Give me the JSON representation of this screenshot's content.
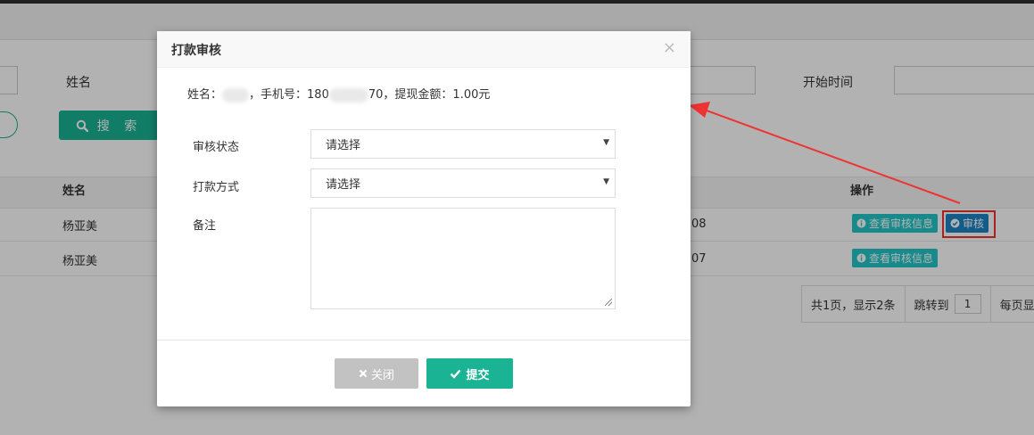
{
  "background": {
    "filter": {
      "name_label": "姓名",
      "start_time_label": "开始时间",
      "search_button": "搜 索"
    },
    "table": {
      "headers": {
        "name": "姓名",
        "actions": "操作"
      },
      "rows": [
        {
          "name": "杨亚美",
          "time_fragment": "08",
          "view_label": "查看审核信息",
          "audit_label": "审核"
        },
        {
          "name": "杨亚美",
          "time_fragment": "07",
          "view_label": "查看审核信息"
        }
      ]
    },
    "pager": {
      "summary": "共1页，显示2条",
      "jump_label": "跳转到",
      "jump_value": "1",
      "per_page_label": "每页显"
    }
  },
  "modal": {
    "title": "打款审核",
    "close_symbol": "×",
    "info": {
      "name_label": "姓名：",
      "phone_label": "，手机号：",
      "phone_prefix": "180",
      "phone_suffix": "70",
      "amount_label": "，提现金额：",
      "amount_value": "1.00元"
    },
    "fields": {
      "audit_status": {
        "label": "审核状态",
        "value": "请选择"
      },
      "payment_method": {
        "label": "打款方式",
        "value": "请选择"
      },
      "remark": {
        "label": "备注",
        "value": ""
      }
    },
    "buttons": {
      "close": "关闭",
      "submit": "提交"
    }
  },
  "colors": {
    "primary": "#1ab394",
    "info": "#23c6c8",
    "audit": "#1c84c6",
    "annotation": "#ee3333",
    "disabled": "#c2c2c2"
  },
  "icons": {
    "search": "search-icon",
    "info": "info-circle-icon",
    "check": "check-circle-icon",
    "close": "times-icon",
    "submit": "check-icon"
  }
}
